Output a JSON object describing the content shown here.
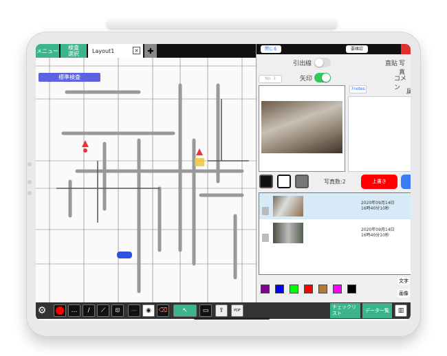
{
  "tabs": {
    "menu": "メニュー",
    "inspection_select": "検査\n選択",
    "layout": "Layout1",
    "close": "✕",
    "add": "✚"
  },
  "standard_inspection": "標準検査",
  "panel": {
    "close": "閉じる",
    "needs_confirm": "要確認",
    "leader_line": "引出線",
    "leader_line_on": false,
    "arrow": "矢印",
    "arrow_on": true,
    "number": "No. 3",
    "notes": "7notes",
    "direct_paste": "直貼",
    "photo": "写真",
    "comment": "コメン",
    "other": "属",
    "photo_count": "写真数:2",
    "overwrite": "上書き",
    "photos": [
      {
        "date": "2020年09月14日",
        "time": "16時40分10秒",
        "selected": true
      },
      {
        "date": "2020年09月14日",
        "time": "16時40分10秒",
        "selected": false
      }
    ],
    "colors": [
      "#800090",
      "#0000ff",
      "#00ff00",
      "#ff0000",
      "#b07a3c",
      "#ff00ff",
      "#000000"
    ],
    "text_btn": "文字",
    "image_btn": "画像"
  },
  "toolbar": {
    "icons": [
      "gear-icon",
      "record-icon",
      "comment-icon",
      "pen-icon",
      "rectangle-icon",
      "stamp-icon",
      "measure-icon",
      "camera-icon",
      "eraser-icon",
      "select-icon",
      "monitor-icon",
      "export-icon",
      "pdf-icon"
    ],
    "stamp_label": "印",
    "pdf_label": "PDF",
    "checklist": "チェックリスト",
    "data_list": "データ一覧"
  }
}
